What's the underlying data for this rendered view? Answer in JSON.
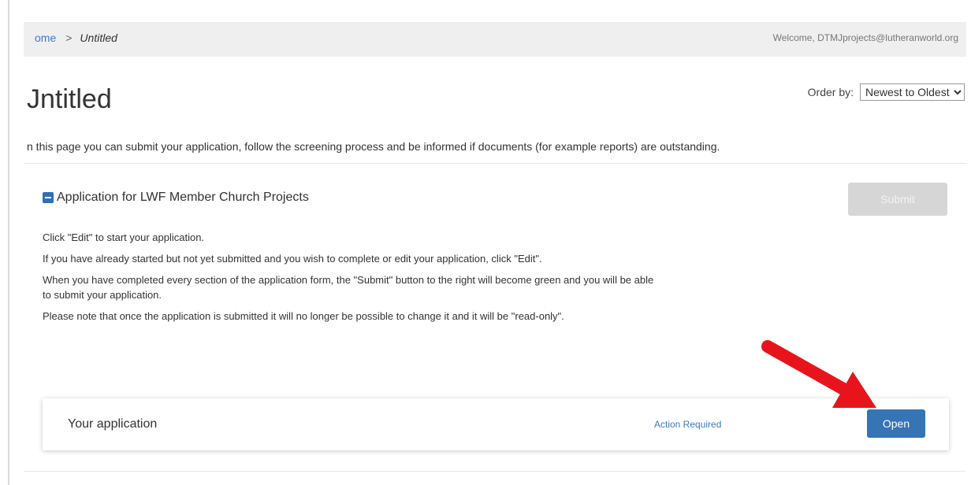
{
  "breadcrumb": {
    "home": "ome",
    "separator": ">",
    "current": "Untitled"
  },
  "header": {
    "welcome": "Welcome, DTMJprojects@lutheranworld.org"
  },
  "page": {
    "title": "Jntitled"
  },
  "order_by": {
    "label": "Order by:",
    "selected": "Newest to Oldest"
  },
  "intro": "n this page you can submit your application, follow the screening process and be informed if documents (for example reports) are outstanding.",
  "card": {
    "title": "Application for LWF Member Church Projects",
    "submit_label": "Submit",
    "instructions": [
      "Click \"Edit\" to start your application.",
      "If you have already started but not yet submitted and you wish to complete or edit your application, click \"Edit\".",
      "When you have completed every section of the application form, the \"Submit\" button to the right will become green and you will be able to submit your application.",
      "Please note that once the application is submitted it will no longer be possible to change it and it will be \"read-only\"."
    ]
  },
  "application": {
    "label": "Your application",
    "status": "Action Required",
    "open_label": "Open"
  },
  "colors": {
    "accent": "#3574b5",
    "link": "#3d7bbf",
    "disabled_button": "#d6d6d6",
    "arrow": "#e8141c"
  },
  "icons": {
    "collapse": "minus-square-icon",
    "annotation": "red-arrow-icon"
  }
}
